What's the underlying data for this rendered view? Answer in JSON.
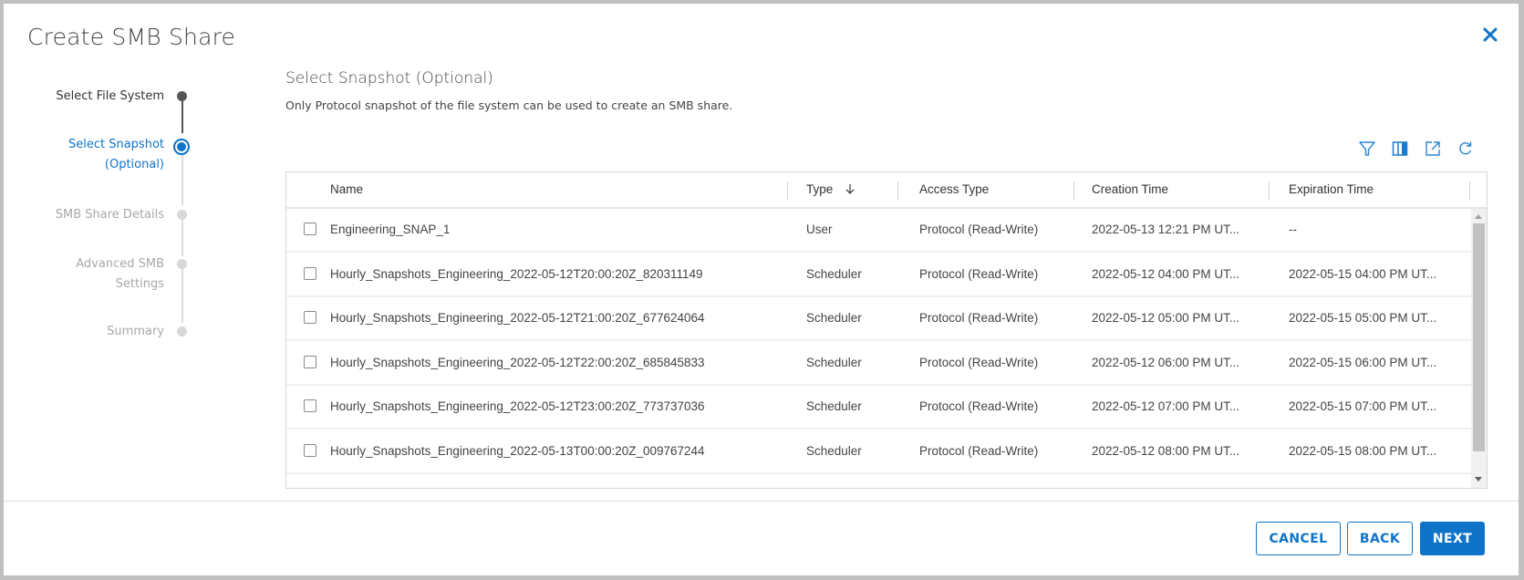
{
  "dialog": {
    "title": "Create SMB Share",
    "close_icon": "close-icon"
  },
  "stepper": {
    "steps": [
      {
        "label_line1": "Select File System",
        "label_line2": "",
        "state": "completed"
      },
      {
        "label_line1": "Select Snapshot",
        "label_line2": "(Optional)",
        "state": "current"
      },
      {
        "label_line1": "SMB Share Details",
        "label_line2": "",
        "state": "pending"
      },
      {
        "label_line1": "Advanced SMB",
        "label_line2": "Settings",
        "state": "pending"
      },
      {
        "label_line1": "Summary",
        "label_line2": "",
        "state": "pending"
      }
    ]
  },
  "main": {
    "heading": "Select Snapshot (Optional)",
    "description": "Only Protocol snapshot of the file system can be used to create an SMB share.",
    "toolbar": {
      "icons": [
        "filter-icon",
        "columns-icon",
        "export-icon",
        "refresh-icon"
      ]
    },
    "table": {
      "columns": [
        "Name",
        "Type",
        "Access Type",
        "Creation Time",
        "Expiration Time"
      ],
      "sort": {
        "column": "Type",
        "direction": "descending",
        "icon": "arrow-down-icon"
      },
      "rows": [
        {
          "name": "Engineering_SNAP_1",
          "type": "User",
          "access_type": "Protocol (Read-Write)",
          "creation_time": "2022-05-13 12:21 PM UT...",
          "expiration_time": "--",
          "checked": false
        },
        {
          "name": "Hourly_Snapshots_Engineering_2022-05-12T20:00:20Z_820311149",
          "type": "Scheduler",
          "access_type": "Protocol (Read-Write)",
          "creation_time": "2022-05-12 04:00 PM UT...",
          "expiration_time": "2022-05-15 04:00 PM UT...",
          "checked": false
        },
        {
          "name": "Hourly_Snapshots_Engineering_2022-05-12T21:00:20Z_677624064",
          "type": "Scheduler",
          "access_type": "Protocol (Read-Write)",
          "creation_time": "2022-05-12 05:00 PM UT...",
          "expiration_time": "2022-05-15 05:00 PM UT...",
          "checked": false
        },
        {
          "name": "Hourly_Snapshots_Engineering_2022-05-12T22:00:20Z_685845833",
          "type": "Scheduler",
          "access_type": "Protocol (Read-Write)",
          "creation_time": "2022-05-12 06:00 PM UT...",
          "expiration_time": "2022-05-15 06:00 PM UT...",
          "checked": false
        },
        {
          "name": "Hourly_Snapshots_Engineering_2022-05-12T23:00:20Z_773737036",
          "type": "Scheduler",
          "access_type": "Protocol (Read-Write)",
          "creation_time": "2022-05-12 07:00 PM UT...",
          "expiration_time": "2022-05-15 07:00 PM UT...",
          "checked": false
        },
        {
          "name": "Hourly_Snapshots_Engineering_2022-05-13T00:00:20Z_009767244",
          "type": "Scheduler",
          "access_type": "Protocol (Read-Write)",
          "creation_time": "2022-05-12 08:00 PM UT...",
          "expiration_time": "2022-05-15 08:00 PM UT...",
          "checked": false
        }
      ]
    }
  },
  "footer": {
    "cancel_label": "CANCEL",
    "back_label": "BACK",
    "next_label": "NEXT"
  },
  "colors": {
    "accent": "#0f74c8",
    "completed": "#555555",
    "pending": "#d8d8d8",
    "pending_text": "#a8a8a8"
  }
}
